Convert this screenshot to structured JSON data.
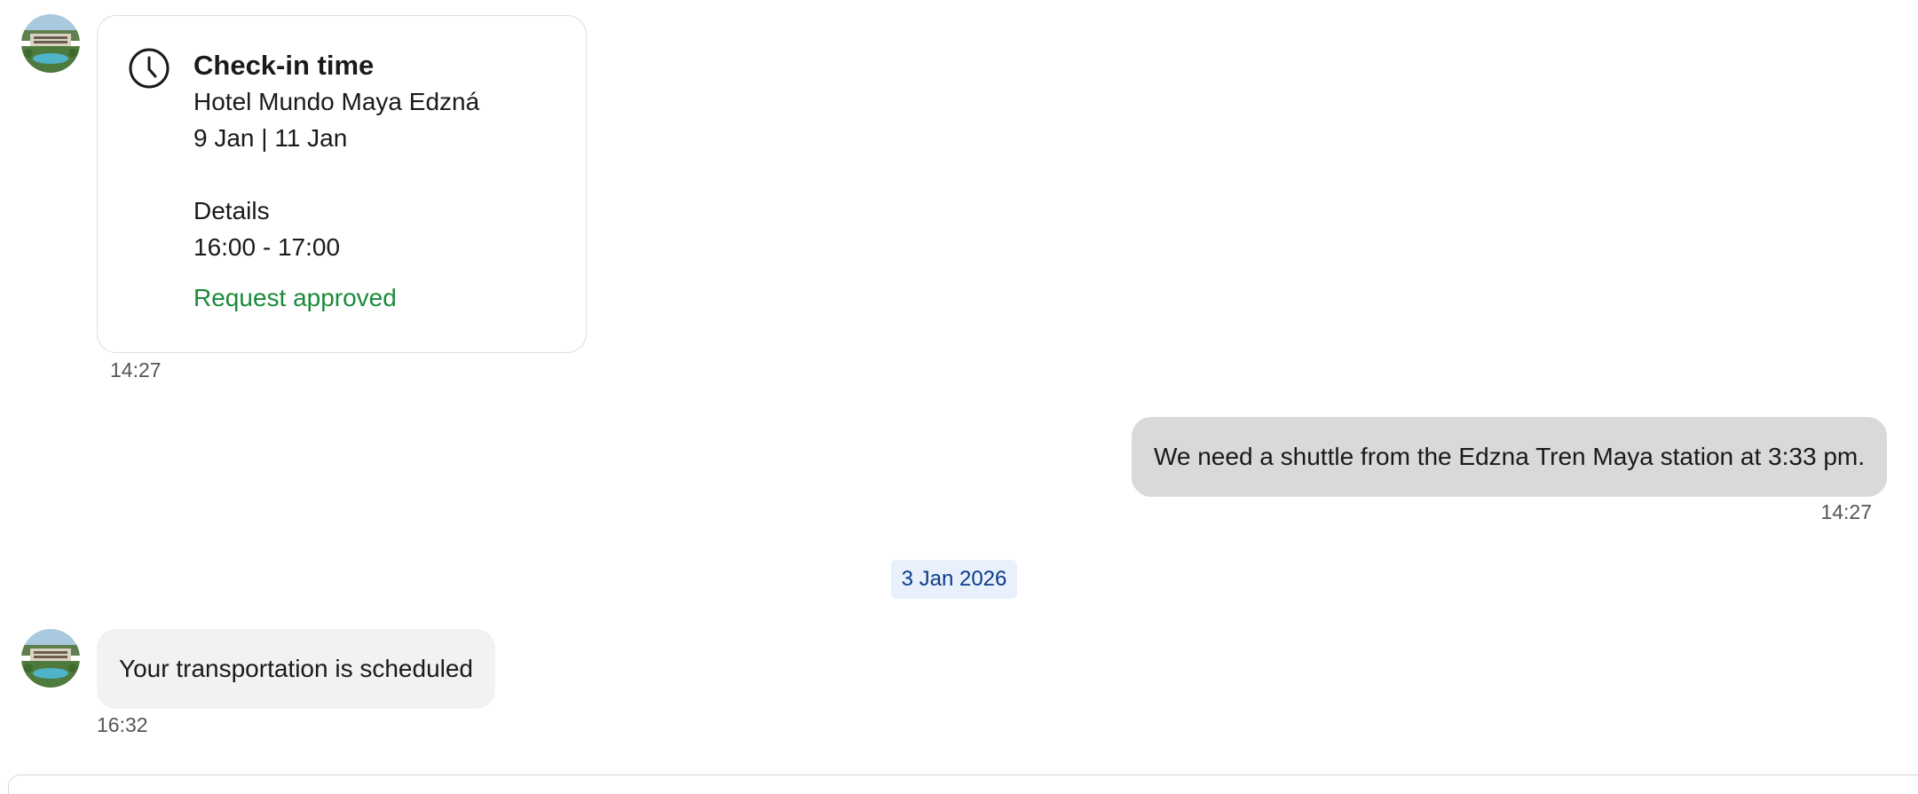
{
  "messages": {
    "card": {
      "icon": "clock-icon",
      "title": "Check-in time",
      "hotel": "Hotel Mundo Maya Edzná",
      "dates": "9 Jan | 11 Jan",
      "details_label": "Details",
      "details_value": "16:00 - 17:00",
      "status": "Request approved",
      "status_color": "#1b8a3a",
      "time": "14:27"
    },
    "outgoing": {
      "text": "We need a shuttle from the Edzna Tren Maya station at 3:33 pm.",
      "time": "14:27"
    },
    "date_separator": "3 Jan 2026",
    "incoming": {
      "text": "Your transportation is scheduled",
      "time": "16:32"
    }
  },
  "avatar": {
    "icon": "hotel-avatar-icon"
  },
  "colors": {
    "outgoing_bubble": "#d9d9d9",
    "incoming_bubble": "#f2f2f2",
    "date_badge_bg": "#e8f1fb",
    "date_badge_text": "#0b3b8a"
  }
}
